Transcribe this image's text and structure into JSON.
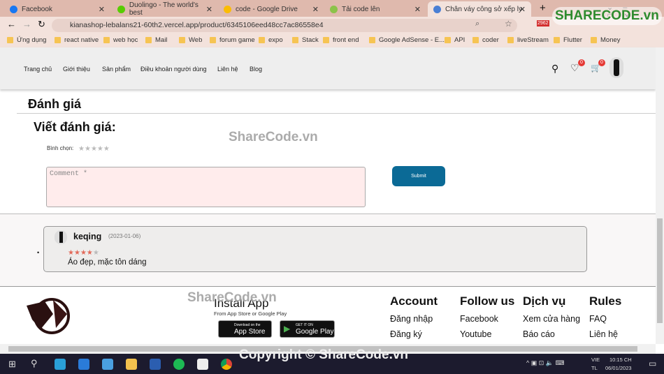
{
  "browser": {
    "tabs": [
      {
        "label": "Facebook",
        "color": "#1877f2"
      },
      {
        "label": "Duolingo - The world's best",
        "color": "#58cc02"
      },
      {
        "label": "code - Google Drive",
        "color": "#fbbc04"
      },
      {
        "label": "Tải code lên",
        "color": "#8bc34a"
      },
      {
        "label": "Chân váy công sở xếp ly",
        "color": "#4a7fd4"
      }
    ],
    "url": "kianashop-lebalans21-60th2.vercel.app/product/6345106eed48cc7ac86558e4",
    "bookmarks": [
      "Ứng dụng",
      "react native",
      "web học",
      "Mail",
      "Web",
      "forum game",
      "expo",
      "Stack",
      "front end",
      "Google AdSense - E...",
      "API",
      "coder",
      "liveStream",
      "Flutter",
      "Money"
    ],
    "ext_badge": "2962"
  },
  "nav": {
    "items": [
      "Trang chủ",
      "Giới thiệu",
      "Sản phẩm",
      "Điều khoản người dùng",
      "Liên hệ",
      "Blog"
    ],
    "wishlist_count": "0",
    "cart_count": "0"
  },
  "review": {
    "section_title": "Đánh giá",
    "write_title": "Viết đánh giá:",
    "vote_label": "Bình chọn:",
    "vote_value": 0,
    "comment_placeholder": "Comment *",
    "submit_label": "Submit",
    "accent": "#0b6a96",
    "comments": [
      {
        "user": "keqing",
        "date": "(2023-01-06)",
        "rating": 4,
        "text": "Áo đẹp, mặc tôn dáng"
      }
    ]
  },
  "footer": {
    "install_title": "Install App",
    "install_sub": "From App Store or Google Play",
    "app_store_small": "Download on the",
    "app_store": "App Store",
    "google_play_small": "GET IT ON",
    "google_play": "Google Play",
    "columns": [
      {
        "title": "Account",
        "links": [
          "Đăng nhập",
          "Đăng ký"
        ]
      },
      {
        "title": "Follow us",
        "links": [
          "Facebook",
          "Youtube"
        ]
      },
      {
        "title": "Dịch vụ",
        "links": [
          "Xem cửa hàng",
          "Báo cáo"
        ]
      },
      {
        "title": "Rules",
        "links": [
          "FAQ",
          "Liên hệ"
        ]
      }
    ]
  },
  "watermarks": {
    "logo": "SHARECODE.vn",
    "mid": "ShareCode.vn",
    "copyright": "Copyright © ShareCode.vn"
  },
  "taskbar": {
    "lang1": "VIE",
    "lang2": "TL",
    "time": "10:15 CH",
    "date": "06/01/2023"
  }
}
